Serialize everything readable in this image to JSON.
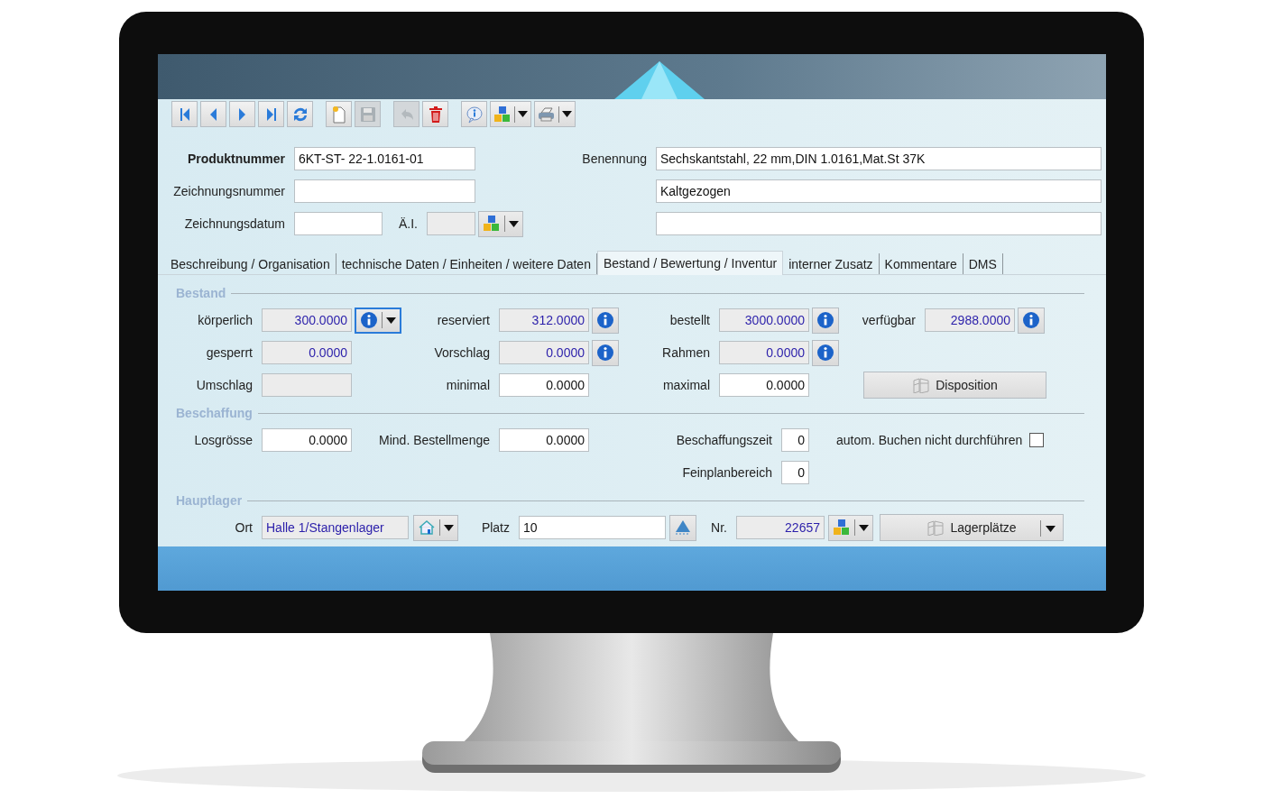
{
  "toolbar": [
    [
      {
        "kind": "first",
        "disabled": false
      },
      {
        "kind": "previous",
        "disabled": false
      },
      {
        "kind": "next",
        "disabled": false
      },
      {
        "kind": "last",
        "disabled": false
      },
      {
        "kind": "refresh",
        "disabled": false
      }
    ],
    [
      {
        "kind": "new",
        "disabled": false
      },
      {
        "kind": "save",
        "disabled": true
      }
    ],
    [
      {
        "kind": "undo",
        "disabled": true
      },
      {
        "kind": "delete",
        "disabled": false
      }
    ],
    [
      {
        "kind": "info",
        "disabled": false
      },
      {
        "kind": "cubes",
        "disabled": false,
        "menu": true
      },
      {
        "kind": "printer",
        "disabled": false,
        "menu": true
      }
    ]
  ],
  "header": {
    "fields": [
      {
        "label": "Produktnummer",
        "value": "6KT-ST- 22-1.0161-01",
        "bold": true
      },
      {
        "label": "Zeichnungsnummer",
        "bold": false
      },
      {
        "label": "Zeichnungsdatum",
        "bold": false
      }
    ],
    "revision": {
      "label": "Ä.I."
    },
    "name": {
      "label": "Benennung",
      "lines": [
        "Sechskantstahl, 22 mm,DIN 1.0161,Mat.St 37K",
        "Kaltgezogen"
      ]
    }
  },
  "tabs": [
    {
      "label": "Beschreibung / Organisation",
      "selected": false
    },
    {
      "label": "technische Daten / Einheiten / weitere Daten",
      "selected": false
    },
    {
      "label": "Bestand / Bewertung / Inventur",
      "selected": true
    },
    {
      "label": "interner Zusatz",
      "selected": false
    },
    {
      "label": "Kommentare",
      "selected": false
    },
    {
      "label": "DMS",
      "selected": false
    }
  ],
  "bestand": {
    "title": "Bestand",
    "rows": [
      [
        {
          "kind": "field",
          "label": "körperlich",
          "value": "300.0000",
          "editable": false,
          "info_button": true,
          "menu": true,
          "focused": true
        },
        {
          "kind": "field",
          "label": "reserviert",
          "value": "312.0000",
          "editable": false,
          "info_button": true
        },
        {
          "kind": "field",
          "label": "bestellt",
          "value": "3000.0000",
          "editable": false,
          "info_button": true
        },
        {
          "kind": "field",
          "label": "verfügbar",
          "value": "2988.0000",
          "editable": false,
          "info_button": true
        }
      ],
      [
        {
          "kind": "field",
          "label": "gesperrt",
          "value": "0.0000",
          "editable": false
        },
        {
          "kind": "field",
          "label": "Vorschlag",
          "value": "0.0000",
          "editable": false,
          "info_button": true
        },
        {
          "kind": "field",
          "label": "Rahmen",
          "value": "0.0000",
          "editable": false,
          "info_button": true
        }
      ],
      [
        {
          "kind": "field",
          "label": "Umschlag",
          "editable": false
        },
        {
          "kind": "field",
          "label": "minimal",
          "value": "0.0000",
          "editable": true
        },
        {
          "kind": "field",
          "label": "maximal",
          "value": "0.0000",
          "editable": true
        },
        {
          "kind": "action",
          "label": "Disposition"
        }
      ]
    ]
  },
  "beschaffung": {
    "title": "Beschaffung",
    "left": [
      {
        "label": "Losgrösse",
        "value": "0.0000",
        "editable": true
      },
      {
        "label": "Mind. Bestellmenge",
        "value": "0.0000",
        "editable": true
      }
    ],
    "right": [
      {
        "label": "Beschaffungszeit",
        "value": "0",
        "editable": true
      },
      {
        "label": "Feinplanbereich",
        "value": "0",
        "editable": true
      }
    ],
    "option": {
      "label": "autom. Buchen nicht durchführen",
      "checked": false
    }
  },
  "hauptlager": {
    "title": "Hauptlager",
    "location": {
      "label": "Ort",
      "value": "Halle 1/Stangenlager"
    },
    "place": {
      "label": "Platz",
      "value": "10"
    },
    "number": {
      "label": "Nr.",
      "value": "22657"
    },
    "places_button": {
      "label": "Lagerplätze"
    }
  }
}
